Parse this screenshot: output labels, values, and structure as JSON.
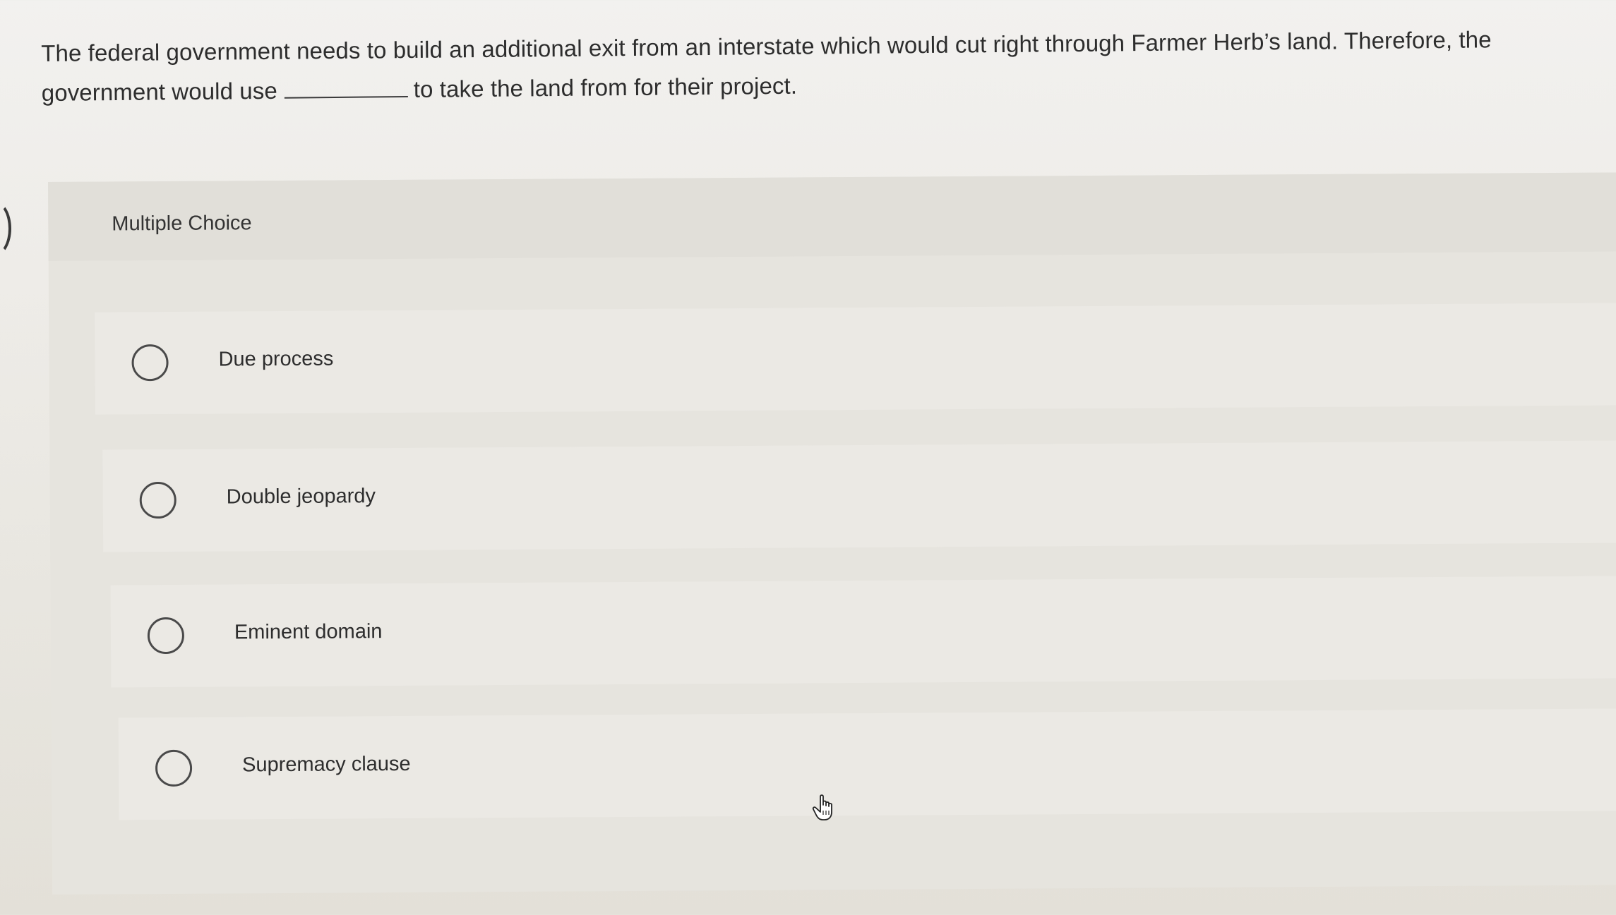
{
  "question": {
    "text_before": "The federal government needs to build an additional exit from an interstate which would cut right through Farmer Herb’s land. Therefore, the government would use",
    "text_after": "to take the land from for their project."
  },
  "multiple_choice": {
    "title": "Multiple Choice",
    "options": [
      {
        "label": "Due process",
        "selected": false
      },
      {
        "label": "Double jeopardy",
        "selected": false
      },
      {
        "label": "Eminent domain",
        "selected": false
      },
      {
        "label": "Supremacy clause",
        "selected": false
      }
    ]
  },
  "icons": {
    "cursor": "hand-pointer-icon",
    "radio": "radio-unchecked-icon"
  },
  "colors": {
    "background": "#eeece8",
    "text": "#2d2d2d",
    "radio_border": "#4a4a4a"
  }
}
